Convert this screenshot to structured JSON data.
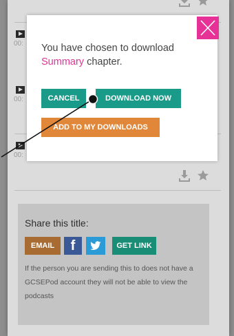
{
  "colors": {
    "accent": "#e63297",
    "teal": "#1a9b8a",
    "orange": "#e0873a",
    "email": "#a86c33",
    "facebook": "#3b5997",
    "twitter": "#2a9bd6"
  },
  "episodes": [
    {
      "duration": "00:"
    },
    {
      "duration": "00:"
    },
    {
      "duration": "00:"
    }
  ],
  "modal": {
    "message_prefix": "You have chosen to download",
    "chapter_name": "Summary",
    "message_suffix": " chapter.",
    "cancel_label": "CANCEL",
    "download_now_label": "DOWNLOAD NOW",
    "add_to_downloads_label": "ADD TO MY DOWNLOADS",
    "close_icon": "close-icon"
  },
  "share": {
    "title": "Share this title:",
    "email_label": "EMAIL",
    "facebook_glyph": "f",
    "twitter_icon": "twitter-bird-icon",
    "get_link_label": "GET LINK",
    "note": "If the person you are sending this to does not have a GCSEPod account they will not be able to view the podcasts"
  }
}
